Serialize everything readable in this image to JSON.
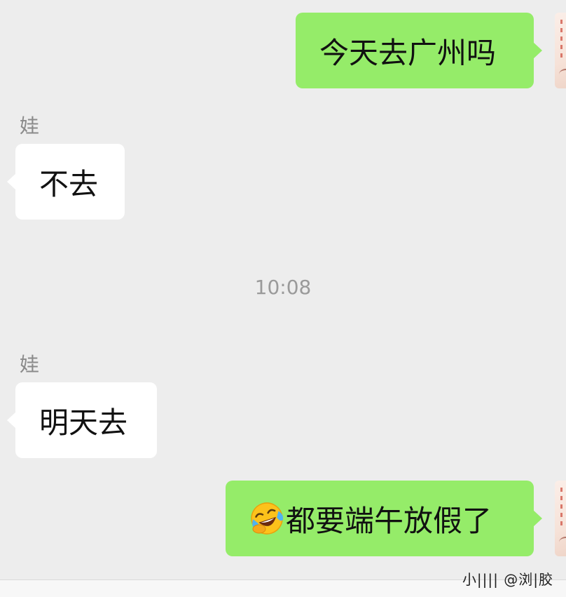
{
  "messages": [
    {
      "direction": "out",
      "sender": "",
      "text": "今天去广州吗"
    },
    {
      "direction": "in",
      "sender": "娃",
      "text": "不去"
    },
    {
      "direction": "in",
      "sender": "娃",
      "text": "明天去"
    },
    {
      "direction": "out",
      "sender": "",
      "emoji": "face-with-tears-of-joy-emoji",
      "text": "都要端午放假了"
    }
  ],
  "timestamp": "10:08",
  "watermark": "小|||| @浏|胶",
  "colors": {
    "background": "#ededed",
    "incoming_bubble": "#ffffff",
    "outgoing_bubble": "#95ec69",
    "sender_name": "#8a8a8a",
    "timestamp": "#9a9a9a"
  },
  "icons": {
    "self_avatar": "self-avatar-image"
  }
}
